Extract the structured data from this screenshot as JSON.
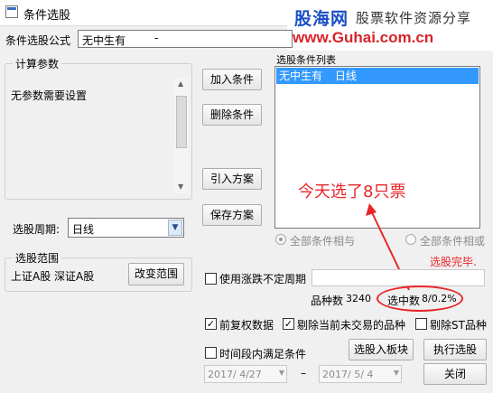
{
  "window": {
    "title": "条件选股"
  },
  "watermark": {
    "brand": "股海网",
    "slogan": "股票软件资源分享",
    "url": "www.Guhai.com.cn"
  },
  "formula": {
    "label": "条件选股公式",
    "value": "无中生有",
    "extra": "-"
  },
  "params": {
    "group_label": "计算参数",
    "text": "无参数需要设置"
  },
  "period": {
    "label": "选股周期:",
    "value": "日线"
  },
  "buttons": {
    "add_condition": "加入条件",
    "delete_condition": "删除条件",
    "import_scheme": "引入方案",
    "save_scheme": "保存方案",
    "change_range": "改变范围",
    "to_block": "选股入板块",
    "run": "执行选股",
    "close": "关闭"
  },
  "condition_list": {
    "label": "选股条件列表",
    "items": [
      {
        "name": "无中生有",
        "period": "日线"
      }
    ]
  },
  "logic": {
    "all_and": "全部条件相与",
    "all_or": "全部条件相或"
  },
  "range": {
    "group_label": "选股范围",
    "value": "上证A股 深证A股"
  },
  "annotation": {
    "text": "今天选了8只票",
    "color": "#e8262a"
  },
  "status": {
    "done": "选股完毕."
  },
  "options": {
    "use_indef_period": "使用涨跌不定周期",
    "forward_adjust": "前复权数据",
    "exclude_untraded": "剔除当前未交易的品种",
    "exclude_st": "剔除ST品种",
    "time_range": "时间段内满足条件"
  },
  "stats": {
    "count_label": "品种数",
    "count_value": "3240",
    "selected_label": "选中数",
    "selected_value": "8/0.2%"
  },
  "dates": {
    "start": "2017/ 4/27",
    "end": "2017/ 5/ 4",
    "separator": "–"
  }
}
